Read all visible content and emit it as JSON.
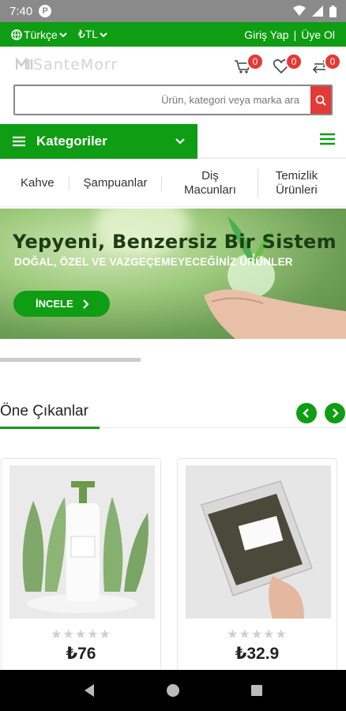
{
  "status": {
    "time": "7:40",
    "app_icon": "P"
  },
  "topbar": {
    "language": "Türkçe",
    "currency": "₺TL",
    "login": "Giriş Yap",
    "separator": "|",
    "register": "Üye Ol"
  },
  "header": {
    "logo": "SanteMorr",
    "cart_count": "0",
    "wishlist_count": "0",
    "compare_count": "0"
  },
  "search": {
    "placeholder": "Ürün, kategori veya marka ara"
  },
  "categories": {
    "label": "Kategoriler"
  },
  "nav": {
    "items": [
      "Kahve",
      "Şampuanlar",
      "Diş Macunları",
      "Temizlik Ürünleri"
    ]
  },
  "hero": {
    "title": "Yepyeni, Benzersiz Bir Sistem",
    "subtitle": "DOĞAL, ÖZEL VE VAZGEÇEMEYECEĞİNİZ ÜRÜNLER",
    "cta": "İNCELE"
  },
  "featured": {
    "title": "Öne Çıkanlar"
  },
  "products": [
    {
      "price": "₺76",
      "stars": "★★★★★",
      "image": "lotion-bottle"
    },
    {
      "price": "₺32.9",
      "stars": "★★★★★",
      "image": "tea-pouch"
    }
  ],
  "colors": {
    "brand": "#0f9d13",
    "badge": "#e53935"
  }
}
